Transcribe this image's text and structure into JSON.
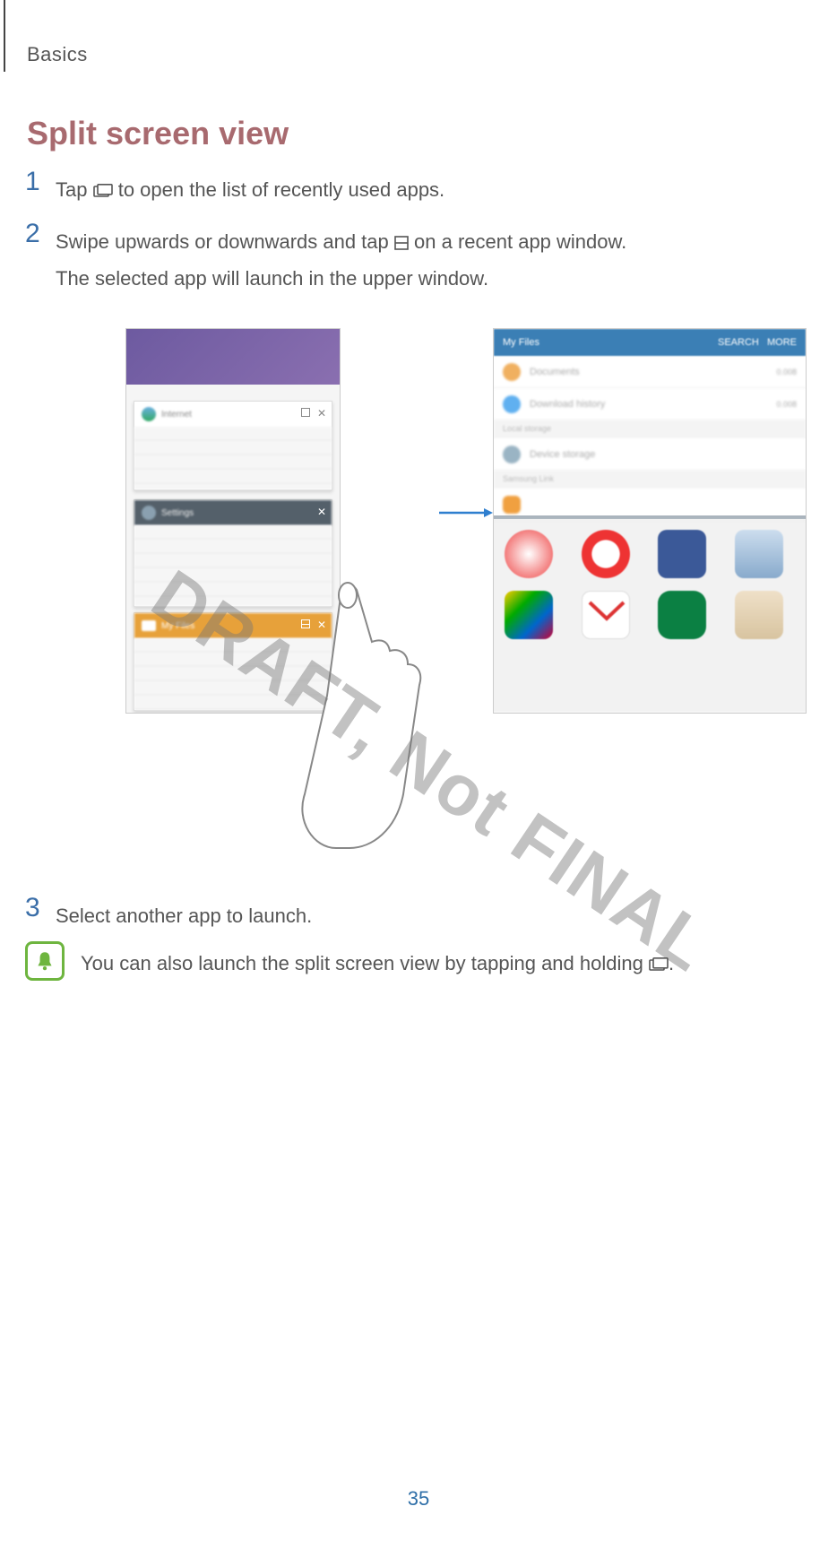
{
  "chapter": "Basics",
  "heading": "Split screen view",
  "steps": [
    {
      "num": "1",
      "pre": "Tap ",
      "post": " to open the list of recently used apps."
    },
    {
      "num": "2",
      "pre": "Swipe upwards or downwards and tap ",
      "post": " on a recent app window.",
      "line2": "The selected app will launch in the upper window."
    },
    {
      "num": "3",
      "pre": "Select another app to launch."
    }
  ],
  "note": {
    "pre": "You can also launch the split screen view by tapping and holding ",
    "post": "."
  },
  "watermark": "DRAFT, Not FINAL",
  "page_number": "35",
  "figure": {
    "phone_b": {
      "title": "My Files",
      "actions": [
        "SEARCH",
        "MORE"
      ],
      "rows": [
        {
          "label": "Documents",
          "tail": "0.008"
        },
        {
          "label": "Download history",
          "tail": "0.008"
        }
      ],
      "section1": "Local storage",
      "device_row": "Device storage",
      "section2": "Samsung Link"
    }
  }
}
